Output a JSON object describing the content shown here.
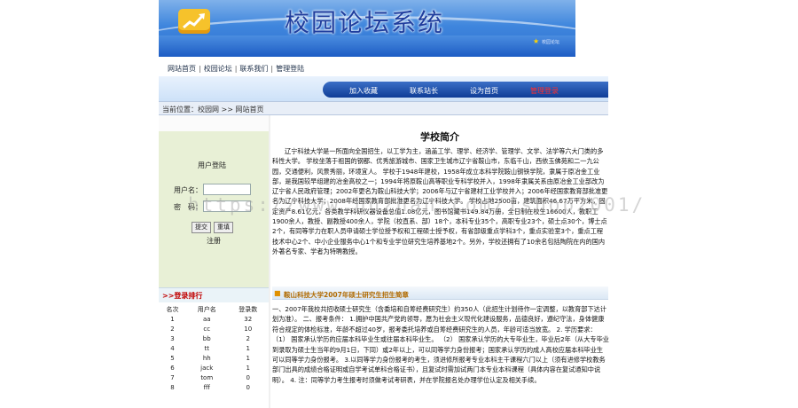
{
  "banner": {
    "title": "校园论坛系统",
    "site_text": "校园论坛"
  },
  "toplinks": [
    "网站首页",
    "校园论坛",
    "联系我们",
    "管理登陆"
  ],
  "nav": [
    "加入收藏",
    "联系站长",
    "设为首页",
    "管理登录"
  ],
  "location": "当前位置：校园网 >> 网站首页",
  "login": {
    "title": "用户登陆",
    "username_label": "用户名：",
    "password_label": "密　码：",
    "submit": "提交",
    "reset": "重填",
    "register": "注册"
  },
  "rank": {
    "title": ">>登录排行",
    "headers": [
      "名次",
      "用户名",
      "登录数"
    ],
    "rows": [
      [
        "1",
        "aa",
        "32"
      ],
      [
        "2",
        "cc",
        "10"
      ],
      [
        "3",
        "bb",
        "2"
      ],
      [
        "4",
        "tt",
        "1"
      ],
      [
        "5",
        "hh",
        "1"
      ],
      [
        "6",
        "jack",
        "1"
      ],
      [
        "7",
        "tom",
        "0"
      ],
      [
        "8",
        "fff",
        "0"
      ]
    ]
  },
  "content": {
    "title": "学校简介",
    "intro": "辽宁科技大学是一所面向全国招生，以工学为主，涵盖工学、理学、经济学、管理学、文学、法学等六大门类的多科性大学。 学校坐落于祖国的钢都、优秀旅游城市、国家卫生城市辽宁省鞍山市，东临千山，西依玉佛苑和二一九公园，交通便利，风景秀丽，环境宜人。 学校于1948年建校，1958年成立本科学院鞍山钢铁学院，隶属于原冶金工业部，是我国较早组建的冶金高校之一；1994年将原鞍山高等职业专科学校并入，1998年隶属关系由原冶金工业部改为辽宁省人民政府管理；2002年更名为鞍山科技大学；2006年与辽宁省建材工业学校并入；2006年经国家教育部批准更名为辽宁科技大学；2008年经国家教育部批准更名为辽宁科技大学。 学校占地2500亩，建筑面积46.67万平方米，固定资产8.61亿元，各类教学科研仪器设备总值1.08亿元，图书馆藏书149.84万册，全日制在校生16600人，教职工1900余人，教授、副教授400余人，学院（校直系、部）18个，本科专业35个，高职专业23个，硕士点30个，博士点2个，有同等学力在职人员申请硕士学位授予权和工程硕士授予权，有省部级重点学科3个，重点实验室3个，重点工程技术中心2个、中小企业服务中心1个和专业学位研究生培养基地2个。另外，学校还拥有了10余名包括陶院在内的国内外著名专家、学者为特聘教授。",
    "news_title": "鞍山科技大学2007年硕士研究生招生简章",
    "news_body": "一、2007年我校共招收硕士研究生（含委培和自筹经费研究生）约350人（此招生计划待作一定调整，以教育部下达计划为准）。 二、报考条件： 1.拥护中国共产党的领导，愿为社会主义现代化建设服务，品德良好，遵纪守法，身体健康符合规定的体检标准，年龄不超过40岁，报考委托培养或自筹经费研究生的人员，年龄可适当放宽。 2. 学历要求： （1） 国家承认学历的应届本科毕业生或往届本科毕业生。 （2） 国家承认学历的大专毕业生，毕业后2年（从大专毕业到录取为硕士生当年的9月1日，下同）或2年以上，可以同等学力身份报考；国家承认学历的成人高校应届本科毕业生可以同等学力身份报考。 3.以同等学力身份报考的考生，须进修所报考专业本科主干课程六门以上（须有进修学校教务部门出具的成绩合格证明或自学考试单科合格证书），且复试时需加试两门本专业本科课程（具体内容在复试通知中说明）。 4. 注：同等学力考生报考时须做考试考研表，并在学院报名处办理学位认定及相关手续。"
  },
  "watermark": "https://www.huzhan.com/ishop2001/"
}
